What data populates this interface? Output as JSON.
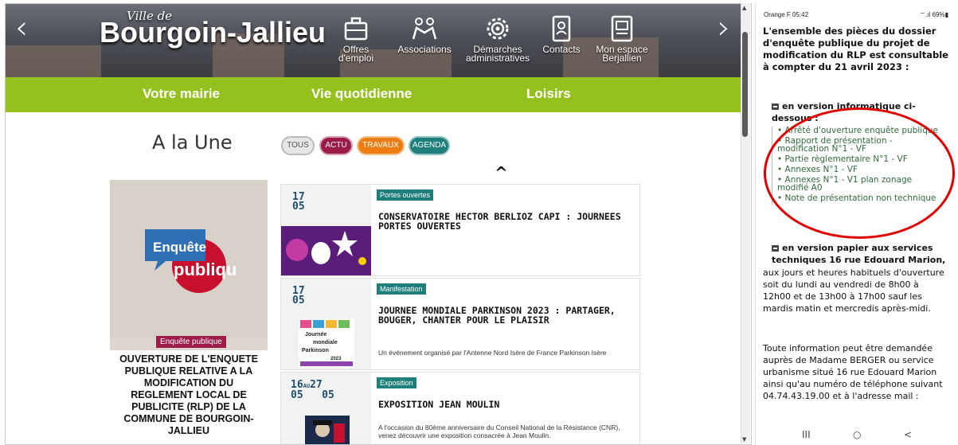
{
  "site": {
    "brand": {
      "ville": "Ville de",
      "name": "Bourgoin-Jallieu"
    },
    "nav_icons": [
      {
        "label": "Offres d'emploi",
        "icon": "briefcase-icon"
      },
      {
        "label": "Associations",
        "icon": "handshake-icon"
      },
      {
        "label": "Démarches administratives",
        "icon": "gear-icon"
      },
      {
        "label": "Contacts",
        "icon": "contacts-book-icon"
      },
      {
        "label": "Mon espace Berjallien",
        "icon": "user-card-icon"
      }
    ],
    "menu": [
      "Votre mairie",
      "Vie quotidienne",
      "Loisirs"
    ],
    "une_title": "A la Une",
    "filters": [
      "TOUS",
      "ACTU",
      "TRAVAUX",
      "AGENDA"
    ],
    "feature": {
      "badge_line1": "Enquête",
      "badge_line2": "publique",
      "category": "Enquête publique",
      "title": "OUVERTURE DE L'ENQUETE PUBLIQUE RELATIVE A LA MODIFICATION DU REGLEMENT LOCAL DE PUBLICITE (RLP) DE LA COMMUNE DE BOURGOIN-JALLIEU"
    },
    "events": [
      {
        "date_day": "17",
        "date_month": "05",
        "tag": "Portes ouvertes",
        "title": "CONSERVATOIRE HECTOR BERLIOZ CAPI : JOURNEES PORTES OUVERTES",
        "desc": ""
      },
      {
        "date_day": "17",
        "date_month": "05",
        "tag": "Manifestation",
        "title": "JOURNEE MONDIALE PARKINSON 2023 : PARTAGER, BOUGER, CHANTER POUR LE PLAISIR",
        "desc": "Un événement organisé par l'Antenne Nord Isère de France Parkinson Isère"
      },
      {
        "date_day": "16",
        "date_month": "05",
        "date_sep": "AU",
        "date_day2": "27",
        "date_month2": "05",
        "tag": "Exposition",
        "title": "EXPOSITION JEAN MOULIN",
        "desc": "A l'occasion du 80ème anniversaire du Conseil National de la Résistance (CNR), venez découvrir une exposition consacrée à Jean Moulin."
      }
    ],
    "parkinson_thumb": {
      "line1": "Journée",
      "line2": "mondiale",
      "line3": "Parkinson",
      "line4": "2023"
    }
  },
  "phone": {
    "status_left": "Orange F  05:42",
    "status_right": "⌔.ıl 69%▮",
    "intro": "L'ensemble des pièces du dossier d'enquête publique du projet de modification du RLP est consultable à compter du 21 avril 2023 :",
    "info_heading": "en version informatique ci-dessous :",
    "links": [
      "Arrêté d'ouverture enquête publique",
      "Rapport de présentation - modification N°1 - VF",
      "Partie règlementaire N°1 - VF",
      "Annexes N°1 - VF",
      "Annexes N°1 - V1 plan zonage modifié A0",
      "Note de présentation non technique"
    ],
    "paper_heading": "en version papier aux services techniques 16 rue Edouard Marion,",
    "paper_text": "aux jours et heures habituels d'ouverture soit du lundi au vendredi de 8h00 à 12h00 et de 13h00 à 17h00 sauf les mardis matin et mercredis après-midi.",
    "contact_text": "Toute information peut être demandée auprès de Madame BERGER ou service urbanisme situé 16 rue Edouard Marion ainsi qu'au numéro de téléphone suivant 04.74.43.19.00 et à l'adresse mail :",
    "nav": {
      "recent": "III",
      "home": "○",
      "back": "<"
    }
  },
  "colors": {
    "green": "#95c11f",
    "actu": "#9c1b48",
    "travaux": "#ed7d12",
    "agenda": "#1f7f7a",
    "highlight": "#e00000"
  }
}
